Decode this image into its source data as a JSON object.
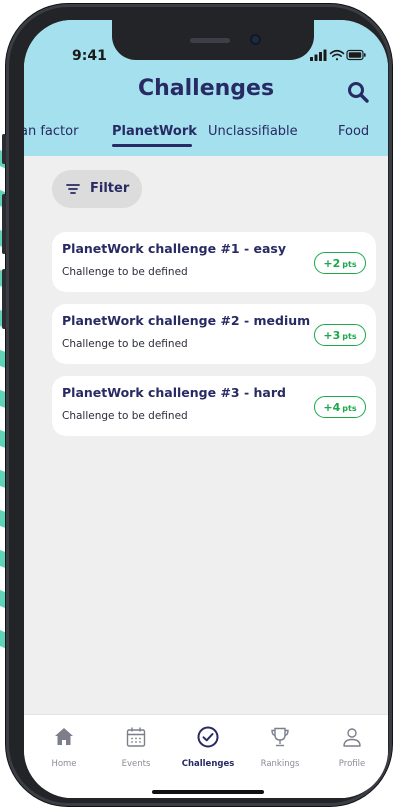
{
  "status_bar": {
    "time": "9:41"
  },
  "header": {
    "title": "Challenges"
  },
  "tabs": [
    {
      "label": "an factor",
      "active": false
    },
    {
      "label": "PlanetWork",
      "active": true
    },
    {
      "label": "Unclassifiable",
      "active": false
    },
    {
      "label": "Food",
      "active": false
    }
  ],
  "filter": {
    "label": "Filter",
    "icon": "filter-icon"
  },
  "challenges": [
    {
      "title": "PlanetWork challenge #1 - easy",
      "subtitle": "Challenge to be defined",
      "points": "+2",
      "unit": "pts"
    },
    {
      "title": "PlanetWork challenge #2 - medium",
      "subtitle": "Challenge to be defined",
      "points": "+3",
      "unit": "pts"
    },
    {
      "title": "PlanetWork challenge #3 - hard",
      "subtitle": "Challenge to be defined",
      "points": "+4",
      "unit": "pts"
    }
  ],
  "bottom_nav": [
    {
      "label": "Home",
      "icon": "home-icon",
      "active": false
    },
    {
      "label": "Events",
      "icon": "calendar-icon",
      "active": false
    },
    {
      "label": "Challenges",
      "icon": "check-circle-icon",
      "active": true
    },
    {
      "label": "Rankings",
      "icon": "trophy-icon",
      "active": false
    },
    {
      "label": "Profile",
      "icon": "user-icon",
      "active": false
    }
  ],
  "colors": {
    "header_bg": "#a5e0ee",
    "primary_text": "#272a63",
    "points_green": "#1aa84a",
    "screen_bg": "#efefef",
    "backdrop_accent": "#5fd3b8"
  }
}
